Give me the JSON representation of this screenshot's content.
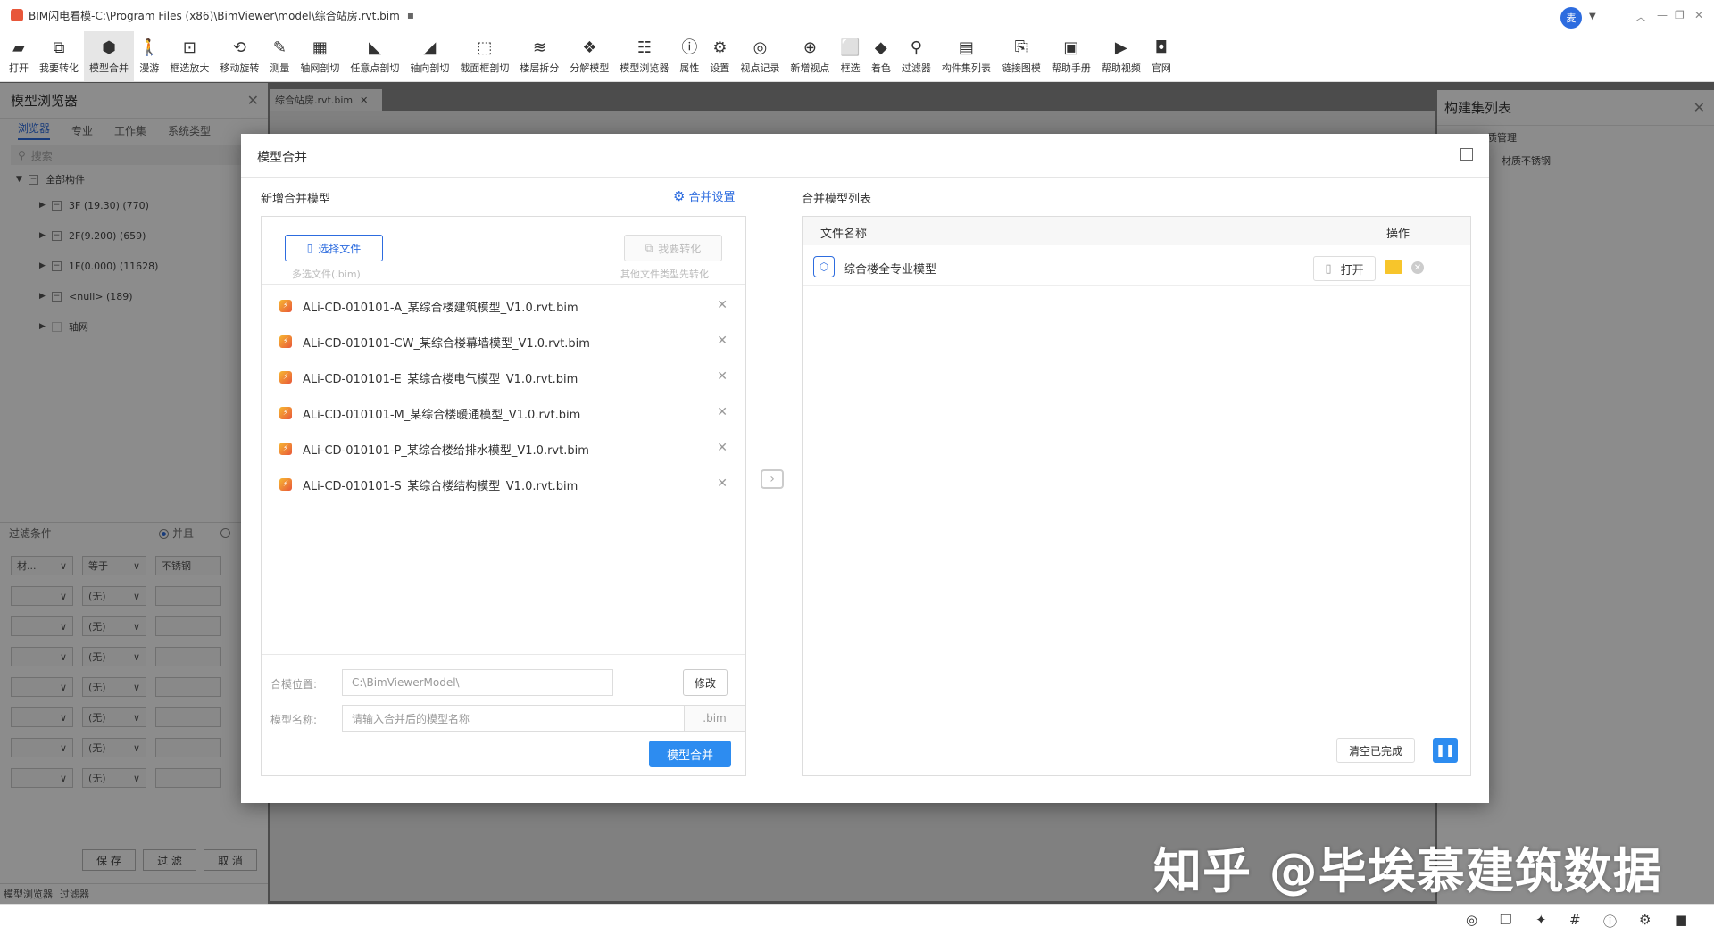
{
  "window": {
    "title": "BIM闪电看模-C:\\Program Files (x86)\\BimViewer\\model\\综合站房.rvt.bim",
    "user_initial": "麦"
  },
  "toolbar": [
    {
      "label": "打开",
      "icon": "folder-icon",
      "glyph": "▰"
    },
    {
      "label": "我要转化",
      "icon": "convert-icon",
      "glyph": "⧉"
    },
    {
      "label": "模型合并",
      "icon": "cube-icon",
      "glyph": "⬢"
    },
    {
      "label": "漫游",
      "icon": "walk-icon",
      "glyph": "🚶"
    },
    {
      "label": "框选放大",
      "icon": "zoom-box-icon",
      "glyph": "⊡"
    },
    {
      "label": "移动旋转",
      "icon": "rotate-icon",
      "glyph": "⟲"
    },
    {
      "label": "测量",
      "icon": "ruler-icon",
      "glyph": "✎"
    },
    {
      "label": "轴网剖切",
      "icon": "grid-cut-icon",
      "glyph": "▦"
    },
    {
      "label": "任意点剖切",
      "icon": "point-cut-icon",
      "glyph": "◣"
    },
    {
      "label": "轴向剖切",
      "icon": "axis-cut-icon",
      "glyph": "◢"
    },
    {
      "label": "截面框剖切",
      "icon": "section-box-icon",
      "glyph": "⬚"
    },
    {
      "label": "楼层拆分",
      "icon": "layers-icon",
      "glyph": "≋"
    },
    {
      "label": "分解模型",
      "icon": "explode-icon",
      "glyph": "❖"
    },
    {
      "label": "模型浏览器",
      "icon": "tree-icon",
      "glyph": "☷"
    },
    {
      "label": "属性",
      "icon": "info-icon",
      "glyph": "ⓘ"
    },
    {
      "label": "设置",
      "icon": "gear-icon",
      "glyph": "⚙"
    },
    {
      "label": "视点记录",
      "icon": "viewpoint-icon",
      "glyph": "◎"
    },
    {
      "label": "新增视点",
      "icon": "add-viewpoint-icon",
      "glyph": "⊕"
    },
    {
      "label": "框选",
      "icon": "select-box-icon",
      "glyph": "⬜"
    },
    {
      "label": "着色",
      "icon": "paint-icon",
      "glyph": "◆"
    },
    {
      "label": "过滤器",
      "icon": "filter-icon",
      "glyph": "⚲"
    },
    {
      "label": "构件集列表",
      "icon": "table-icon",
      "glyph": "▤"
    },
    {
      "label": "链接图模",
      "icon": "link-icon",
      "glyph": "⎘"
    },
    {
      "label": "帮助手册",
      "icon": "book-icon",
      "glyph": "▣"
    },
    {
      "label": "帮助视频",
      "icon": "video-icon",
      "glyph": "▶"
    },
    {
      "label": "官网",
      "icon": "web-icon",
      "glyph": "◘"
    }
  ],
  "left_panel": {
    "title": "模型浏览器",
    "tabs": [
      "浏览器",
      "专业",
      "工作集",
      "系统类型"
    ],
    "search_placeholder": "搜索",
    "root": "全部构件",
    "nodes": [
      "3F (19.30) (770)",
      "2F(9.200) (659)",
      "1F(0.000) (11628)",
      "<null> (189)",
      "轴网"
    ],
    "filter_title": "过滤条件",
    "filter_mode": "并且",
    "filter_row1": [
      "材...",
      "等于",
      "不锈钢"
    ],
    "filter_empty": "(无)",
    "buttons": [
      "保 存",
      "过 滤",
      "取 消"
    ],
    "footer": [
      "模型浏览器",
      "过滤器"
    ]
  },
  "doc_tab": "综合站房.rvt.bim",
  "right_panel": {
    "title": "构建集列表",
    "items": [
      "质管理",
      "材质不锈钢"
    ]
  },
  "modal": {
    "title": "模型合并",
    "left_title": "新增合并模型",
    "settings_label": "合并设置",
    "choose_file": "选择文件",
    "choose_hint": "多选文件(.bim)",
    "convert": "我要转化",
    "convert_hint": "其他文件类型先转化",
    "files": [
      "ALi-CD-010101-A_某综合楼建筑模型_V1.0.rvt.bim",
      "ALi-CD-010101-CW_某综合楼幕墙模型_V1.0.rvt.bim",
      "ALi-CD-010101-E_某综合楼电气模型_V1.0.rvt.bim",
      "ALi-CD-010101-M_某综合楼暖通模型_V1.0.rvt.bim",
      "ALi-CD-010101-P_某综合楼给排水模型_V1.0.rvt.bim",
      "ALi-CD-010101-S_某综合楼结构模型_V1.0.rvt.bim"
    ],
    "location_label": "合模位置:",
    "location_value": "C:\\BimViewerModel\\",
    "modify": "修改",
    "name_label": "模型名称:",
    "name_placeholder": "请输入合并后的模型名称",
    "suffix": ".bim",
    "merge_button": "模型合并",
    "right_title": "合并模型列表",
    "col_name": "文件名称",
    "col_op": "操作",
    "merged": [
      {
        "name": "综合楼全专业模型",
        "open": "打开"
      }
    ],
    "clear_done": "清空已完成"
  },
  "watermark": "知乎 @毕埃慕建筑数据"
}
